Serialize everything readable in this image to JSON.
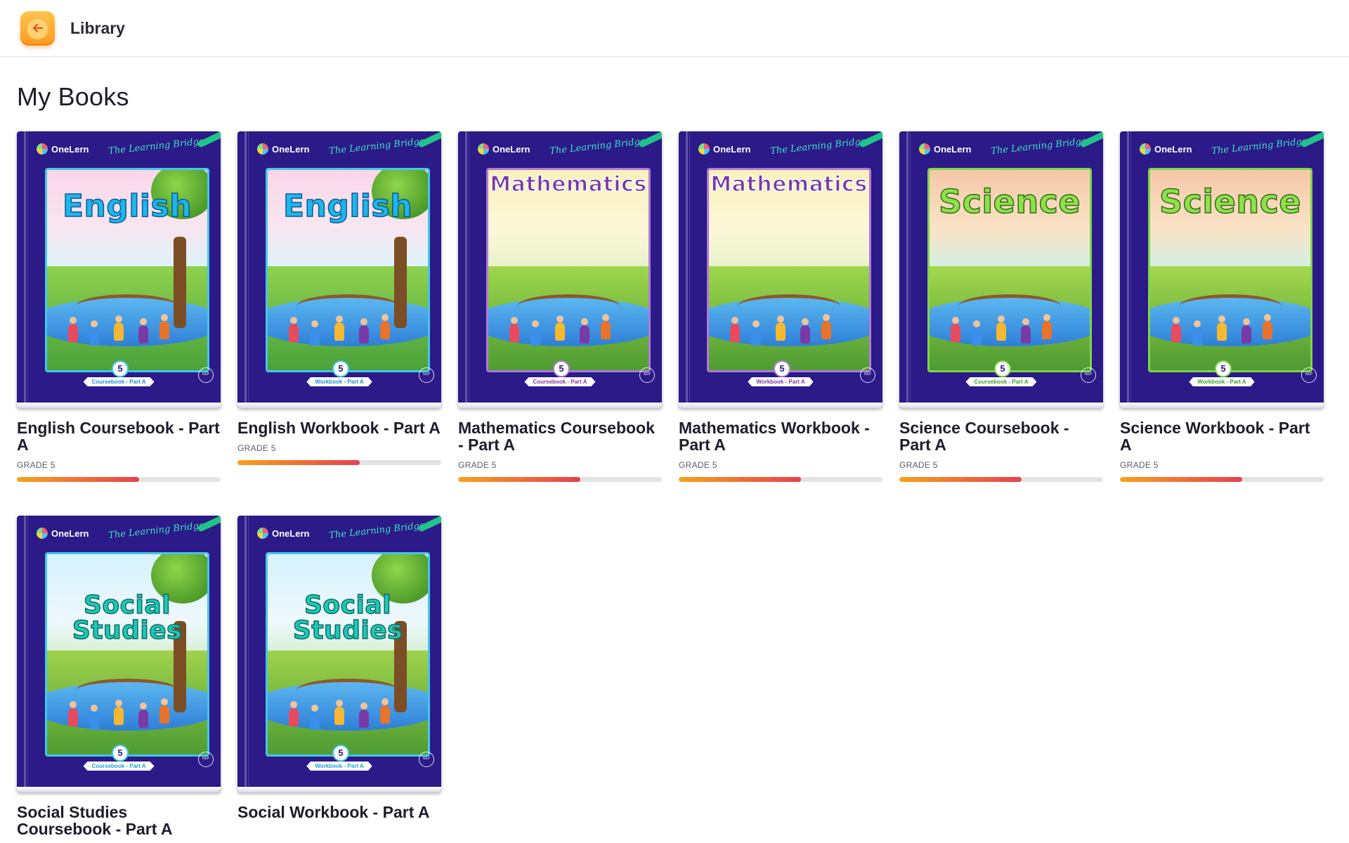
{
  "header": {
    "title": "Library",
    "back_icon": "arrow-left-icon",
    "accent": "#ff9f1c"
  },
  "page": {
    "heading": "My Books"
  },
  "books": [
    {
      "title": "English Coursebook - Part A",
      "grade": "GRADE 5",
      "cover_subject": "English",
      "cover_grade": "5",
      "cover_label": "Coursebook - Part A",
      "progress": 0.6,
      "cover_theme": "english"
    },
    {
      "title": "English Workbook - Part A",
      "grade": "GRADE 5",
      "cover_subject": "English",
      "cover_grade": "5",
      "cover_label": "Workbook - Part A",
      "progress": 0.6,
      "cover_theme": "english"
    },
    {
      "title": "Mathematics Coursebook - Part A",
      "grade": "GRADE 5",
      "cover_subject": "Mathematics",
      "cover_grade": "5",
      "cover_label": "Coursebook - Part A",
      "progress": 0.6,
      "cover_theme": "math"
    },
    {
      "title": "Mathematics Workbook - Part A",
      "grade": "GRADE 5",
      "cover_subject": "Mathematics",
      "cover_grade": "5",
      "cover_label": "Workbook - Part A",
      "progress": 0.6,
      "cover_theme": "math"
    },
    {
      "title": "Science Coursebook - Part A",
      "grade": "GRADE 5",
      "cover_subject": "Science",
      "cover_grade": "5",
      "cover_label": "Coursebook - Part A",
      "progress": 0.6,
      "cover_theme": "science"
    },
    {
      "title": "Science Workbook - Part A",
      "grade": "GRADE 5",
      "cover_subject": "Science",
      "cover_grade": "5",
      "cover_label": "Workbook - Part A",
      "progress": 0.6,
      "cover_theme": "science"
    },
    {
      "title": "Social Studies Coursebook - Part A",
      "grade": "",
      "cover_subject": "Social Studies",
      "cover_grade": "5",
      "cover_label": "Coursebook - Part A",
      "progress": null,
      "cover_theme": "social"
    },
    {
      "title": "Social Workbook - Part A",
      "grade": "",
      "cover_subject": "Social Studies",
      "cover_grade": "5",
      "cover_label": "Workbook - Part A",
      "progress": null,
      "cover_theme": "social"
    }
  ],
  "cover_common": {
    "brand": "OneLern",
    "tagline": "The Learning Bridge",
    "seal": "NEP"
  }
}
